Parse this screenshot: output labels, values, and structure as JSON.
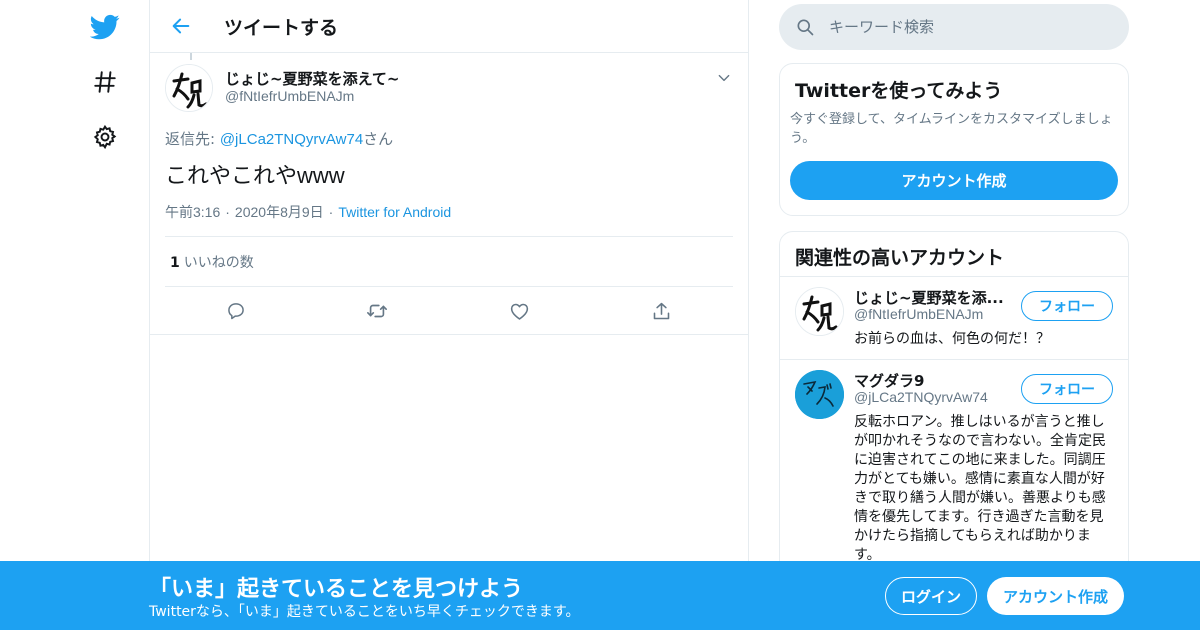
{
  "nav": {
    "items": [
      {
        "icon": "twitter-bird-icon"
      },
      {
        "icon": "hashtag-icon"
      },
      {
        "icon": "gear-icon"
      }
    ]
  },
  "header": {
    "title": "ツイートする"
  },
  "tweet": {
    "author_name": "じょじ~夏野菜を添えて~",
    "author_handle": "@fNtIefrUmbENAJm",
    "reply_prefix": "返信先: ",
    "reply_handle": "@jLCa2TNQyrvAw74",
    "reply_suffix": "さん",
    "text": "これやこれやwww",
    "time": "午前3:16",
    "date": "2020年8月9日",
    "source": "Twitter for Android",
    "like_count": "1",
    "like_label": "いいねの数"
  },
  "search": {
    "placeholder": "キーワード検索"
  },
  "signup_card": {
    "title": "Twitterを使ってみよう",
    "description": "今すぐ登録して、タイムラインをカスタマイズしましょう。",
    "button": "アカウント作成"
  },
  "related": {
    "title": "関連性の高いアカウント",
    "accounts": [
      {
        "name": "じょじ~夏野菜を添...",
        "handle": "@fNtIefrUmbENAJm",
        "follow": "フォロー",
        "bio": "お前らの血は、何色の何だ！？"
      },
      {
        "name": "マグダラ9",
        "handle": "@jLCa2TNQyrvAw74",
        "follow": "フォロー",
        "bio": "反転ホロアン。推しはいるが言うと推しが叩かれそうなので言わない。全肯定民に迫害されてこの地に来ました。同調圧力がとても嫌い。感情に素直な人間が好きで取り繕う人間が嫌い。善悪よりも感情を優先してます。行き過ぎた言動を見かけたら指摘してもらえれば助かります。"
      }
    ]
  },
  "banner": {
    "title": "「いま」起きていることを見つけよう",
    "subtitle": "Twitterなら、「いま」起きていることをいち早くチェックできます。",
    "login": "ログイン",
    "signup": "アカウント作成"
  },
  "colors": {
    "accent": "#1da1f2",
    "link": "#1b95e0",
    "muted": "#657786",
    "border": "#e6ecf0"
  }
}
